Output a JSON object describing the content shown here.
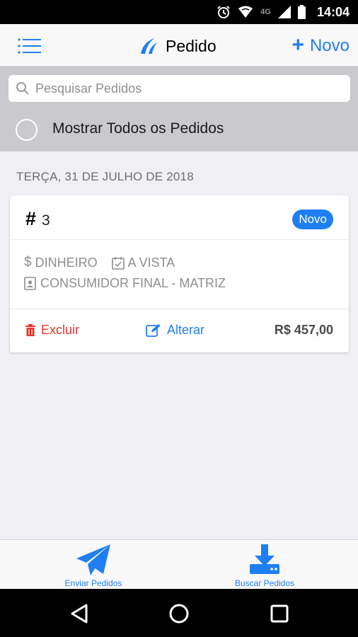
{
  "status_bar": {
    "network": "4G",
    "time": "14:04"
  },
  "header": {
    "title": "Pedido",
    "new_label": "Novo"
  },
  "search": {
    "placeholder": "Pesquisar Pedidos",
    "value": ""
  },
  "filter": {
    "show_all_label": "Mostrar Todos os Pedidos",
    "checked": false
  },
  "date_group": "TERÇA, 31 DE JULHO DE 2018",
  "order": {
    "hash": "#",
    "number": "3",
    "status": "Novo",
    "payment": "DINHEIRO",
    "terms": "A VISTA",
    "customer": "CONSUMIDOR FINAL - MATRIZ",
    "delete_label": "Excluir",
    "edit_label": "Alterar",
    "total": "R$ 457,00"
  },
  "tabs": {
    "send_label": "Enviar Pedidos",
    "fetch_label": "Buscar Pedidos"
  },
  "colors": {
    "accent": "#1f7ff2",
    "danger": "#e8322b",
    "muted": "#8e8e93"
  }
}
